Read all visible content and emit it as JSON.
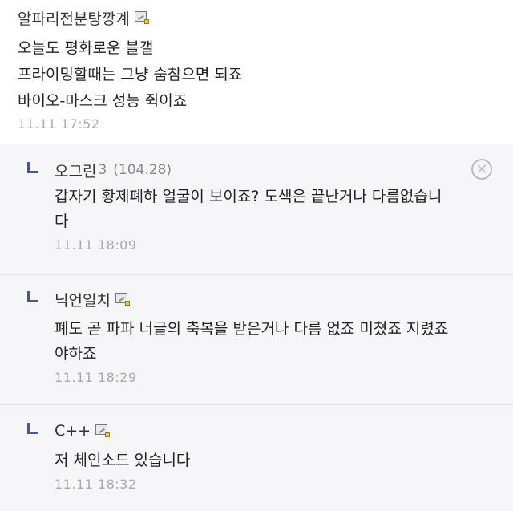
{
  "post": {
    "author": "알파리전분탕깡계",
    "lines": [
      "오늘도 평화로운 블갤",
      "프라이밍할때는 그냥 숨참으면 되죠",
      "바이오-마스크 성능 쥑이죠"
    ],
    "time": "11.11 17:52"
  },
  "replies": [
    {
      "author": "오그린",
      "author_suffix": "3",
      "ip": "(104.28)",
      "lines": [
        "갑자기 황제폐하 얼굴이 보이죠? 도색은 끝난거나 다름없습니",
        "다"
      ],
      "time": "11.11 18:09",
      "delete_symbol": "×"
    },
    {
      "author": "닉언일치",
      "lines": [
        "폐도 곧 파파 너글의 축복을 받은거나 다름 없죠 미쳤죠 지렸죠",
        "야하죠"
      ],
      "time": "11.11 18:29"
    },
    {
      "author": "C++",
      "lines": [
        "저 체인소드 있습니다"
      ],
      "time": "11.11 18:32"
    }
  ],
  "colors": {
    "reply_bg": "#f6f6f8",
    "reply_arrow": "#4a5a86",
    "time_text": "#aaaaaa"
  },
  "icons": {
    "member": "member-badge-icon",
    "reply": "reply-arrow-icon",
    "delete": "delete-icon"
  }
}
